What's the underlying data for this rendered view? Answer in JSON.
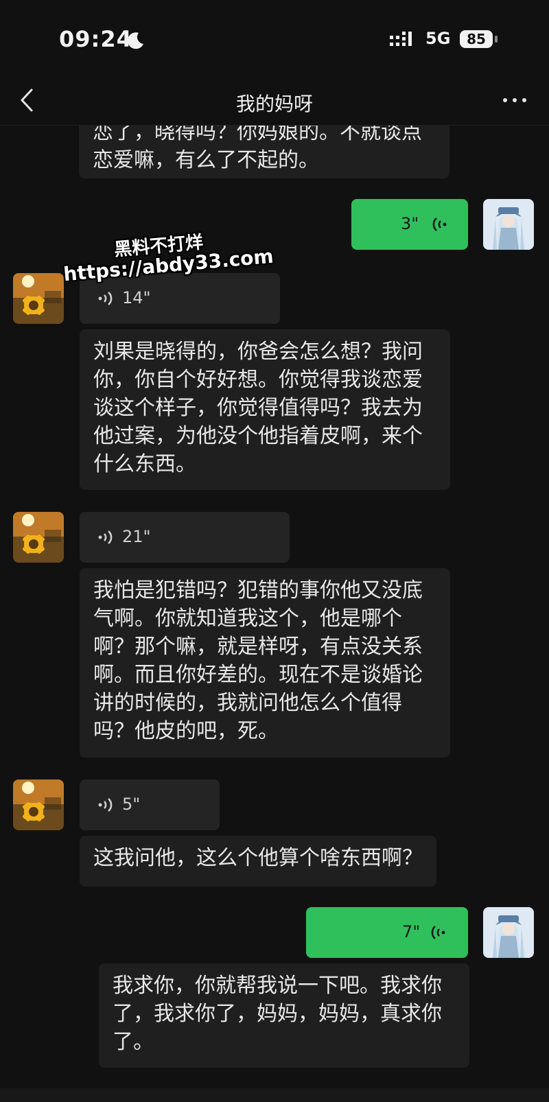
{
  "status_bar": {
    "time": "09:24",
    "network": "5G",
    "battery": "85"
  },
  "header": {
    "title": "我的妈呀"
  },
  "watermark": {
    "line1": "黑料不打烊",
    "line2": "https://abdy33.com"
  },
  "messages": {
    "m0": {
      "text": "恋了，晓得吗？你妈娘的。不就谈点恋爱嘛，有么了不起的。"
    },
    "m1": {
      "duration": "3\""
    },
    "m2": {
      "duration": "14\"",
      "text": "刘果是晓得的，你爸会怎么想？我问你，你自个好好想。你觉得我谈恋爱谈这个样子，你觉得值得吗？我去为他过案，为他没个他指着皮啊，来个什么东西。"
    },
    "m3": {
      "duration": "21\"",
      "text": "我怕是犯错吗？犯错的事你他又没底气啊。你就知道我这个，他是哪个啊？那个嘛，就是样呀，有点没关系啊。而且你好差的。现在不是谈婚论讲的时候的，我就问他怎么个值得吗？他皮的吧，死。"
    },
    "m4": {
      "duration": "5\"",
      "text": "这我问他，这么个他算个啥东西啊？"
    },
    "m5": {
      "duration": "7\"",
      "text": "我求你，你就帮我说一下吧。我求你了，我求你了，妈妈，妈妈，真求你了。"
    }
  },
  "colors": {
    "background": "#111111",
    "bubble": "#1f1f1f",
    "outgoing": "#2fc05c"
  }
}
